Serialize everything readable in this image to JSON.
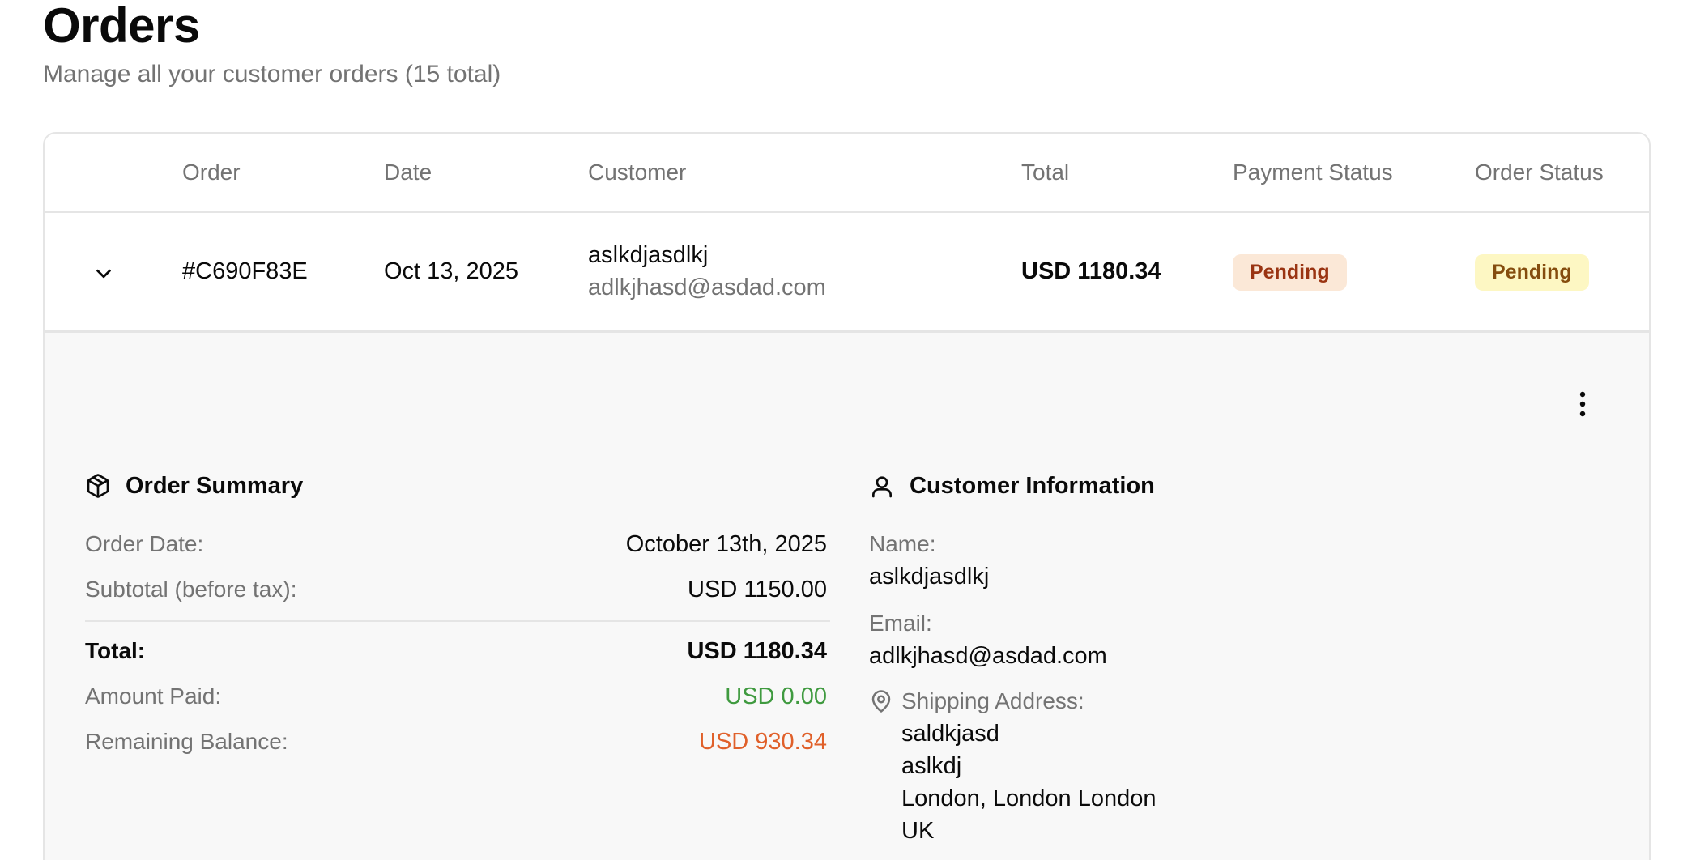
{
  "page": {
    "title": "Orders",
    "subtitle": "Manage all your customer orders (15 total)"
  },
  "table": {
    "columns": [
      "Order",
      "Date",
      "Customer",
      "Total",
      "Payment Status",
      "Order Status"
    ],
    "rows": [
      {
        "order_id": "#C690F83E",
        "date": "Oct 13, 2025",
        "customer_name": "aslkdjasdlkj",
        "customer_email": "adlkjhasd@asdad.com",
        "total": "USD 1180.34",
        "payment_status": "Pending",
        "order_status": "Pending"
      }
    ]
  },
  "details": {
    "order_summary": {
      "title": "Order Summary",
      "icon": "package-icon",
      "order_date_label": "Order Date:",
      "order_date_value": "October 13th, 2025",
      "subtotal_label": "Subtotal (before tax):",
      "subtotal_value": "USD 1150.00",
      "total_label": "Total:",
      "total_value": "USD 1180.34",
      "amount_paid_label": "Amount Paid:",
      "amount_paid_value": "USD 0.00",
      "remaining_label": "Remaining Balance:",
      "remaining_value": "USD 930.34"
    },
    "customer_info": {
      "title": "Customer Information",
      "icon": "user-icon",
      "name_label": "Name:",
      "name_value": "aslkdjasdlkj",
      "email_label": "Email:",
      "email_value": "adlkjhasd@asdad.com",
      "address_icon": "map-pin-icon",
      "address_label": "Shipping Address:",
      "address_lines": [
        "saldkjasd",
        "aslkdj",
        "London, London London",
        "UK"
      ]
    }
  },
  "colors": {
    "payment_badge_bg": "#fbe8d7",
    "payment_badge_text": "#9a3412",
    "order_badge_bg": "#fdf7c3",
    "order_badge_text": "#854d0e",
    "paid_green": "#3f9a3f",
    "remaining_orange": "#e0602a"
  }
}
